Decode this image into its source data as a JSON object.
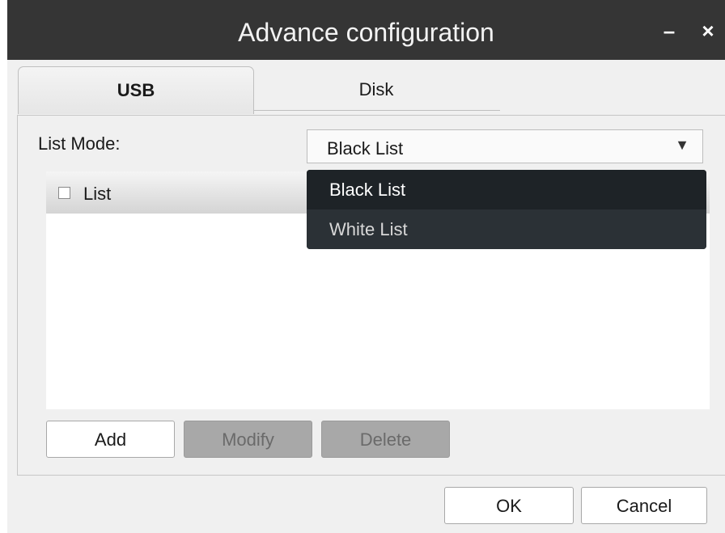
{
  "window": {
    "title": "Advance configuration",
    "minimize_glyph": "–",
    "close_glyph": "×"
  },
  "tabs": [
    {
      "label": "USB",
      "active": true
    },
    {
      "label": "Disk",
      "active": false
    }
  ],
  "list_mode": {
    "label": "List Mode:",
    "selected": "Black List",
    "arrow_glyph": "▼",
    "options": [
      "Black List",
      "White List"
    ]
  },
  "list": {
    "header_label": "List",
    "checked": false,
    "rows": []
  },
  "actions": {
    "add": "Add",
    "modify": "Modify",
    "delete": "Delete"
  },
  "footer": {
    "ok": "OK",
    "cancel": "Cancel"
  },
  "colors": {
    "titlebar": "#353535",
    "dropdown_bg": "#1e2327",
    "disabled_button": "#a8a8a8"
  }
}
